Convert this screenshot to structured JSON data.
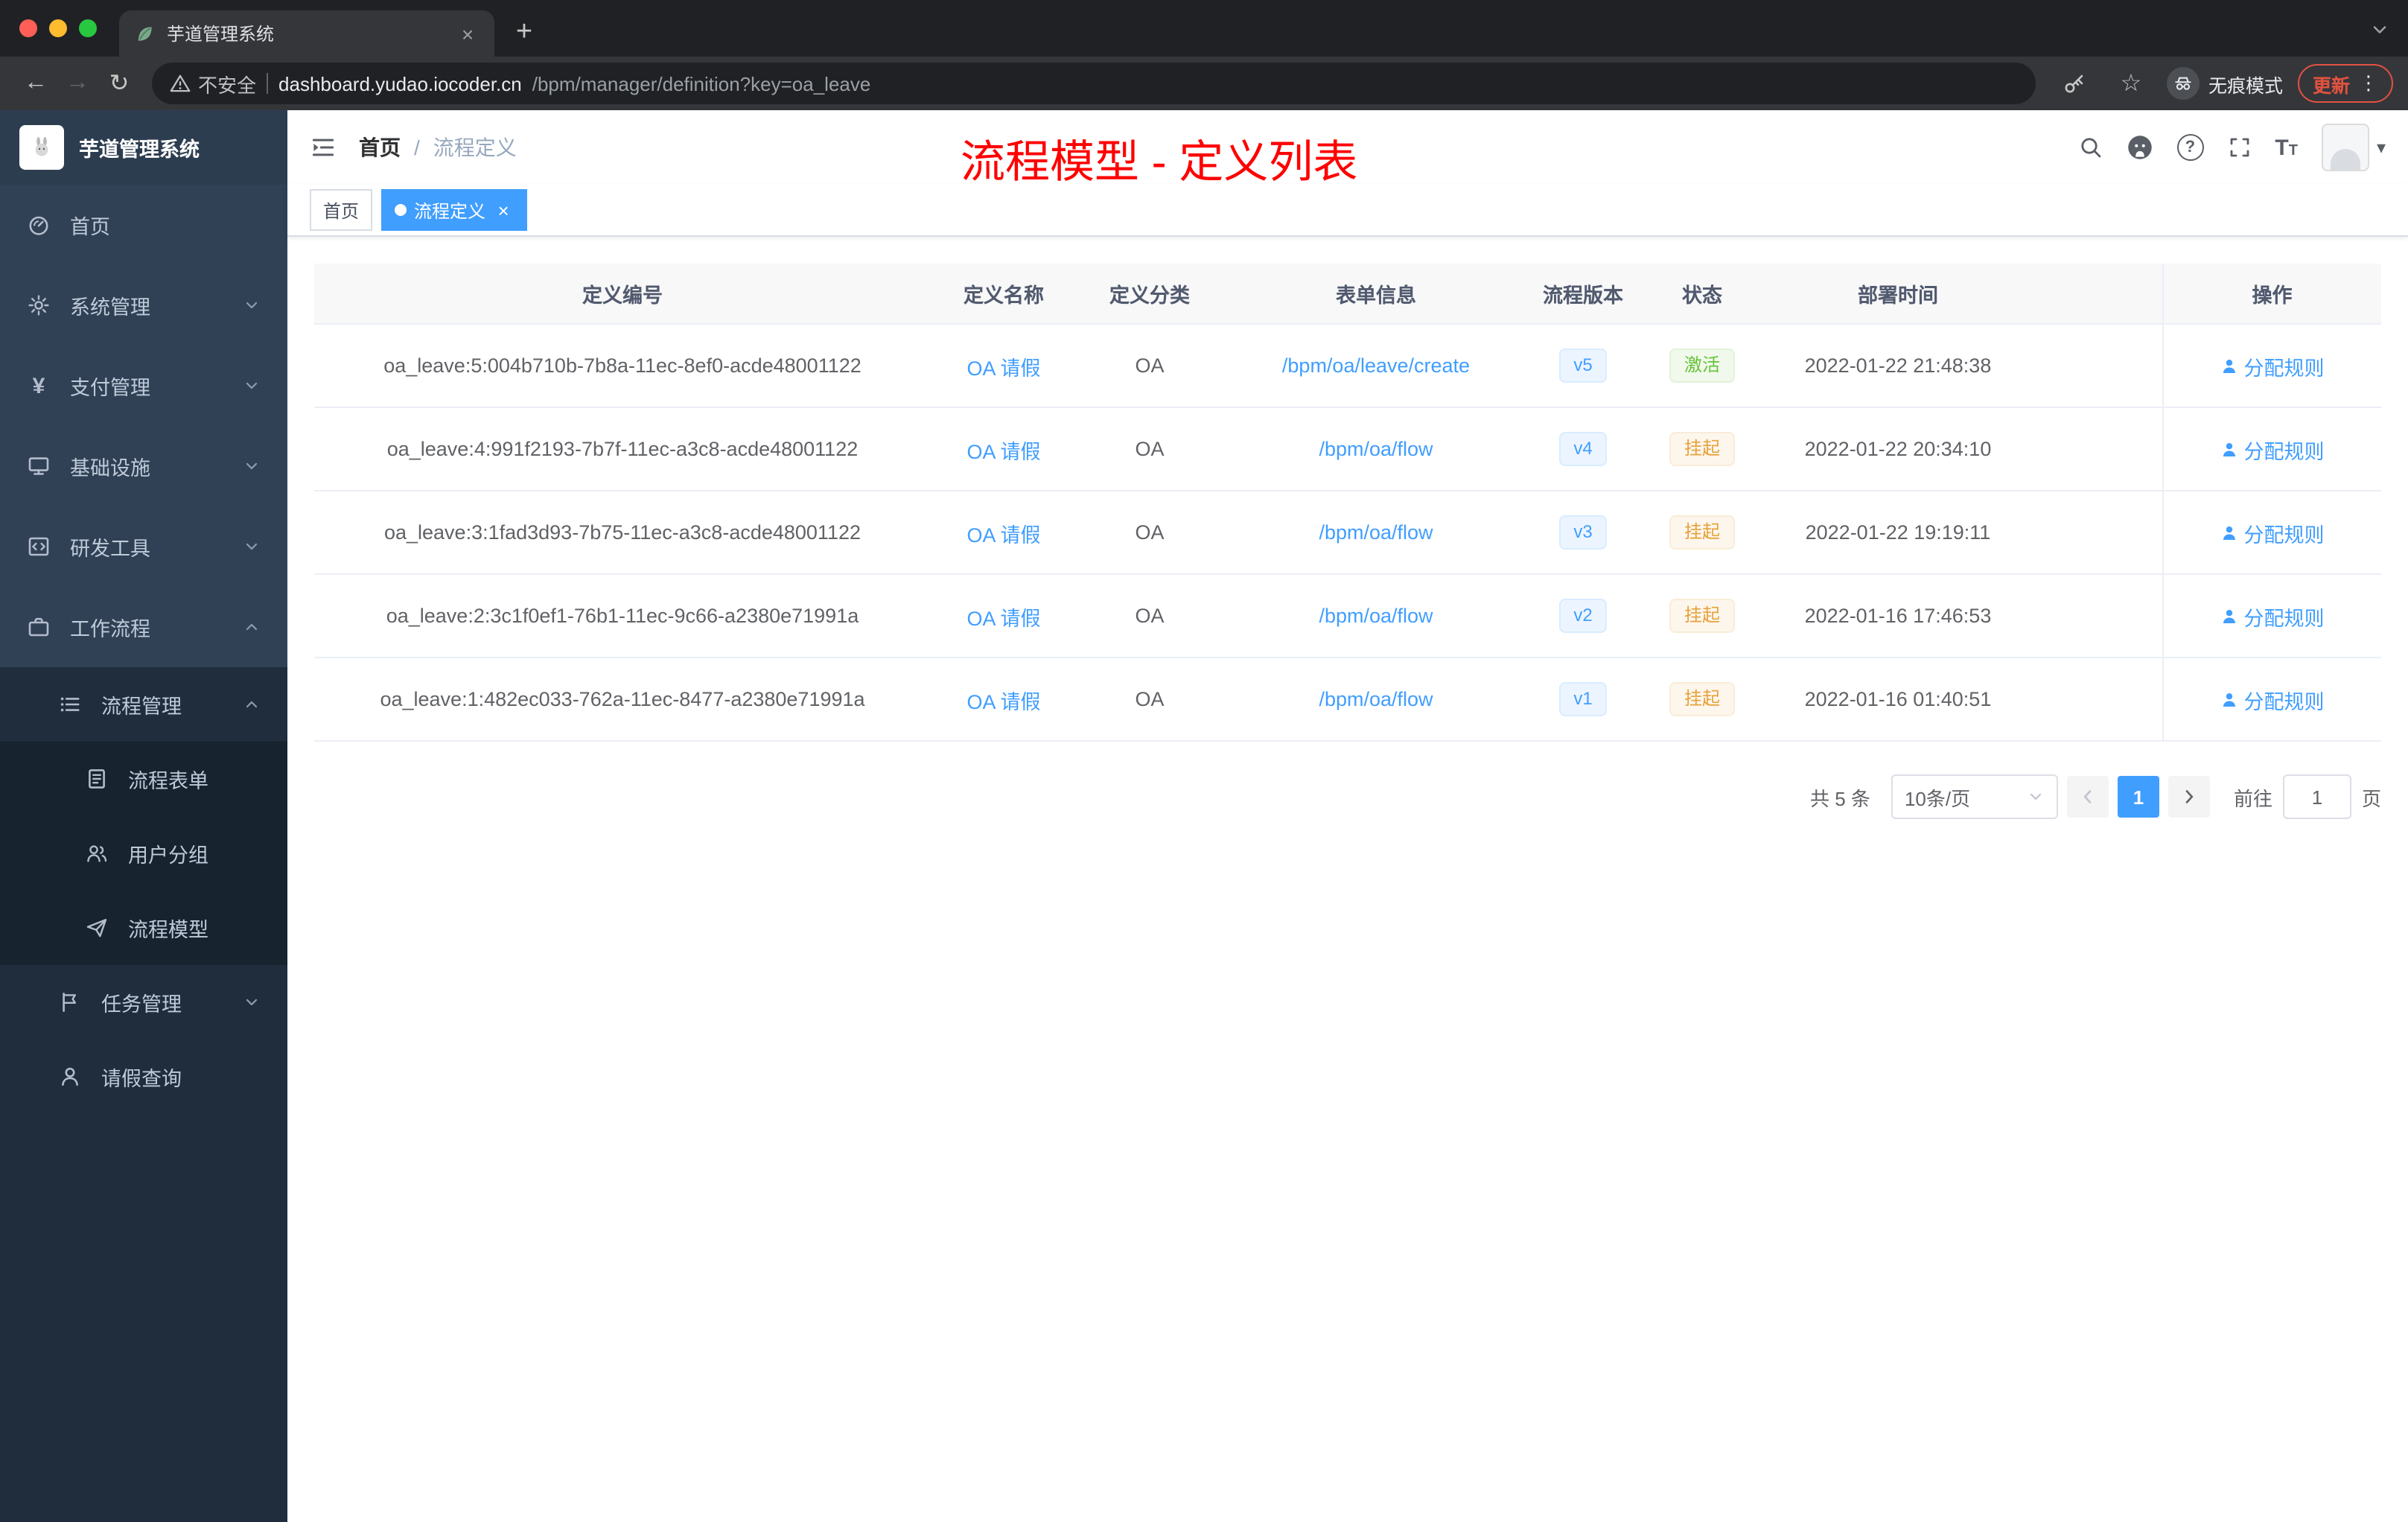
{
  "browser": {
    "tab_title": "芋道管理系统",
    "security_label": "不安全",
    "url_host": "dashboard.yudao.iocoder.cn",
    "url_path": "/bpm/manager/definition?key=oa_leave",
    "incognito_label": "无痕模式",
    "update_label": "更新"
  },
  "icons": {
    "close": "×",
    "plus": "+",
    "back": "←",
    "forward": "→",
    "reload": "↻",
    "star": "☆",
    "dots": "⋮",
    "caret_down": "▾",
    "yen": "¥",
    "question": "?",
    "font_large": "T",
    "font_small": "T"
  },
  "sidebar": {
    "logo_title": "芋道管理系统",
    "menu": [
      {
        "label": "首页"
      },
      {
        "label": "系统管理"
      },
      {
        "label": "支付管理"
      },
      {
        "label": "基础设施"
      },
      {
        "label": "研发工具"
      },
      {
        "label": "工作流程"
      }
    ],
    "submenu": [
      {
        "label": "流程管理"
      },
      {
        "label": "流程表单"
      },
      {
        "label": "用户分组"
      },
      {
        "label": "流程模型"
      },
      {
        "label": "任务管理"
      },
      {
        "label": "请假查询"
      }
    ]
  },
  "header": {
    "breadcrumb": [
      "首页",
      "流程定义"
    ],
    "separator": "/",
    "annotation": "流程模型 - 定义列表"
  },
  "tags": {
    "home": "首页",
    "active": "流程定义"
  },
  "table": {
    "columns": [
      "定义编号",
      "定义名称",
      "定义分类",
      "表单信息",
      "流程版本",
      "状态",
      "部署时间",
      "操作"
    ],
    "rows": [
      {
        "id": "oa_leave:5:004b710b-7b8a-11ec-8ef0-acde48001122",
        "name": "OA 请假",
        "category": "OA",
        "form": "/bpm/oa/leave/create",
        "version": "v5",
        "status": "激活",
        "status_type": "active",
        "time": "2022-01-22 21:48:38",
        "action": "分配规则"
      },
      {
        "id": "oa_leave:4:991f2193-7b7f-11ec-a3c8-acde48001122",
        "name": "OA 请假",
        "category": "OA",
        "form": "/bpm/oa/flow",
        "version": "v4",
        "status": "挂起",
        "status_type": "suspended",
        "time": "2022-01-22 20:34:10",
        "action": "分配规则"
      },
      {
        "id": "oa_leave:3:1fad3d93-7b75-11ec-a3c8-acde48001122",
        "name": "OA 请假",
        "category": "OA",
        "form": "/bpm/oa/flow",
        "version": "v3",
        "status": "挂起",
        "status_type": "suspended",
        "time": "2022-01-22 19:19:11",
        "action": "分配规则"
      },
      {
        "id": "oa_leave:2:3c1f0ef1-76b1-11ec-9c66-a2380e71991a",
        "name": "OA 请假",
        "category": "OA",
        "form": "/bpm/oa/flow",
        "version": "v2",
        "status": "挂起",
        "status_type": "suspended",
        "time": "2022-01-16 17:46:53",
        "action": "分配规则"
      },
      {
        "id": "oa_leave:1:482ec033-762a-11ec-8477-a2380e71991a",
        "name": "OA 请假",
        "category": "OA",
        "form": "/bpm/oa/flow",
        "version": "v1",
        "status": "挂起",
        "status_type": "suspended",
        "time": "2022-01-16 01:40:51",
        "action": "分配规则"
      }
    ]
  },
  "pagination": {
    "total": "共 5 条",
    "page_size": "10条/页",
    "page": "1",
    "goto_label": "前往",
    "goto_value": "1",
    "goto_unit": "页"
  },
  "colors": {
    "accent": "#409eff",
    "annotation_red": "#ff0000",
    "status_active": "#67c23a",
    "status_suspended": "#e6a23c",
    "sidebar_bg": "#304156"
  }
}
